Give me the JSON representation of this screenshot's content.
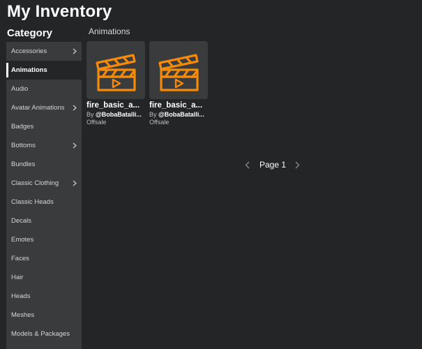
{
  "header": {
    "title": "My Inventory"
  },
  "sidebar": {
    "heading": "Category",
    "items": [
      {
        "label": "Accessories",
        "has_submenu": true
      },
      {
        "label": "Animations",
        "active": true
      },
      {
        "label": "Audio"
      },
      {
        "label": "Avatar Animations",
        "has_submenu": true
      },
      {
        "label": "Badges"
      },
      {
        "label": "Bottoms",
        "has_submenu": true
      },
      {
        "label": "Bundles"
      },
      {
        "label": "Classic Clothing",
        "has_submenu": true
      },
      {
        "label": "Classic Heads"
      },
      {
        "label": "Decals"
      },
      {
        "label": "Emotes"
      },
      {
        "label": "Faces"
      },
      {
        "label": "Hair"
      },
      {
        "label": "Heads"
      },
      {
        "label": "Meshes"
      },
      {
        "label": "Models & Packages"
      }
    ]
  },
  "main": {
    "section_title": "Animations",
    "items": [
      {
        "name": "fire_basic_a...",
        "by": "By",
        "creator": "@BobaBatalli...",
        "price": "Offsale",
        "icon": "clapperboard-play-icon"
      },
      {
        "name": "fire_basic_a...",
        "by": "By",
        "creator": "@BobaBatalli...",
        "price": "Offsale",
        "icon": "clapperboard-play-icon"
      }
    ],
    "pagination": {
      "label": "Page 1"
    }
  },
  "colors": {
    "background": "#232527",
    "sidebar": "#393b3d",
    "accent_orange": "#f58a0b",
    "text_primary": "#ffffff",
    "text_secondary": "#bdbebe"
  }
}
